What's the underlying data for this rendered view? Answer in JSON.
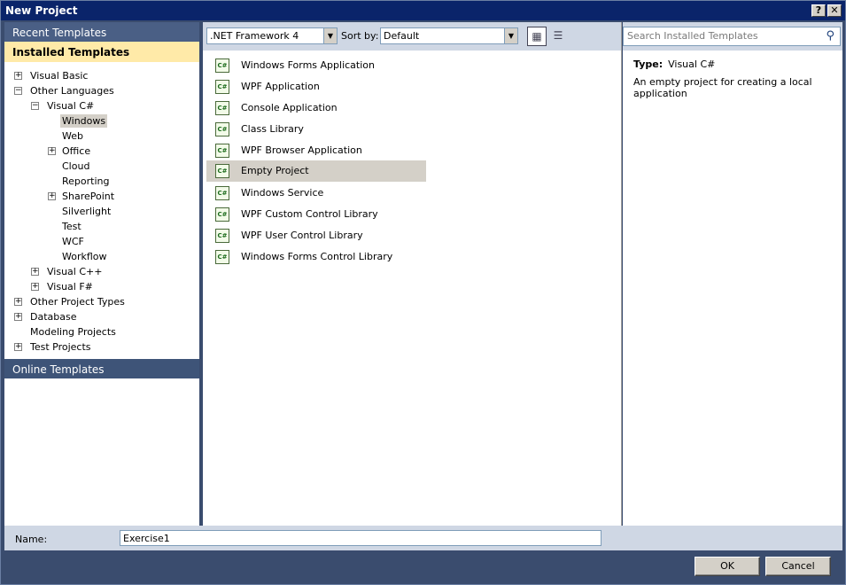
{
  "window": {
    "title": "New Project",
    "help_label": "?",
    "close_label": "✕"
  },
  "left": {
    "recent": "Recent Templates",
    "installed": "Installed Templates",
    "online": "Online Templates",
    "tree": [
      {
        "label": "Visual Basic",
        "expander": "+"
      },
      {
        "label": "Other Languages",
        "expander": "−"
      },
      {
        "label": "Visual C#",
        "expander": "−"
      },
      {
        "label": "Windows"
      },
      {
        "label": "Web"
      },
      {
        "label": "Office",
        "expander": "+"
      },
      {
        "label": "Cloud"
      },
      {
        "label": "Reporting"
      },
      {
        "label": "SharePoint",
        "expander": "+"
      },
      {
        "label": "Silverlight"
      },
      {
        "label": "Test"
      },
      {
        "label": "WCF"
      },
      {
        "label": "Workflow"
      },
      {
        "label": "Visual C++",
        "expander": "+"
      },
      {
        "label": "Visual F#",
        "expander": "+"
      },
      {
        "label": "Other Project Types",
        "expander": "+"
      },
      {
        "label": "Database",
        "expander": "+"
      },
      {
        "label": "Modeling Projects"
      },
      {
        "label": "Test Projects",
        "expander": "+"
      }
    ]
  },
  "toolbar": {
    "framework": ".NET Framework 4",
    "sort_label": "Sort by:",
    "sort_value": "Default",
    "view_medium_icon": "medium-icons-view",
    "view_small_icon": "list-view"
  },
  "templates": [
    {
      "label": "Windows Forms Application",
      "icon": "C#"
    },
    {
      "label": "WPF Application",
      "icon": "C#"
    },
    {
      "label": "Console Application",
      "icon": "C#"
    },
    {
      "label": "Class Library",
      "icon": "C#"
    },
    {
      "label": "WPF Browser Application",
      "icon": "C#"
    },
    {
      "label": "Empty Project",
      "icon": "C#"
    },
    {
      "label": "Windows Service",
      "icon": "C#"
    },
    {
      "label": "WPF Custom Control Library",
      "icon": "C#"
    },
    {
      "label": "WPF User Control Library",
      "icon": "C#"
    },
    {
      "label": "Windows Forms Control Library",
      "icon": "C#"
    }
  ],
  "details": {
    "search_placeholder": "Search Installed Templates",
    "type_label": "Type:",
    "type_value": "Visual C#",
    "description": "An empty project for creating a local application"
  },
  "bottom": {
    "name_label": "Name:",
    "name_value": "Exercise1",
    "ok": "OK",
    "cancel": "Cancel"
  }
}
